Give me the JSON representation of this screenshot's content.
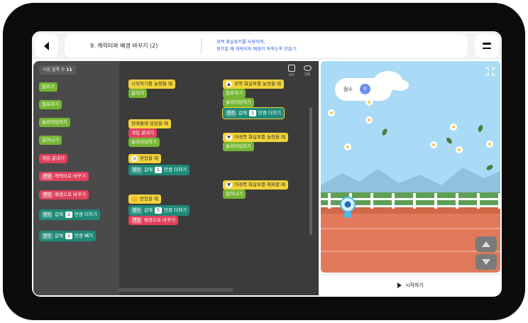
{
  "header": {
    "lesson_title": "9. 캐릭터와 배경 바꾸기 (2)",
    "description_line1": "위쪽 화살표키를 사용하여,",
    "description_line2": "점프할 때 캐릭터와 배경이 바뀌도록 만들기."
  },
  "palette": {
    "count_label": "사용 블록 수",
    "count_value": "11",
    "blocks": {
      "run": "달리기",
      "jump": "점프하기",
      "slide": "슬라이딩하기",
      "stand": "일어나기",
      "end_game": "게임 끝내기",
      "change_char_pick": "랜덤",
      "change_char_text": "캐릭터로 바꾸기",
      "change_bg_pick": "랜덤",
      "change_bg_text": "배경으로 바꾸기",
      "add_var": "점수",
      "add_mid": "값에",
      "add_num": "1",
      "add_text": "만큼 더하기",
      "sub_var": "점수",
      "sub_mid": "값에",
      "sub_num": "1",
      "sub_text": "만큼 빼기"
    }
  },
  "toolbar": {
    "code_label": "코드",
    "view_label": "전화"
  },
  "workspace": {
    "start_event": "시작하기를 눌렀을 때",
    "start_run": "달리기",
    "obstacle_event": "장애물에 닿았을 때",
    "obstacle_end": "게임 끝내기",
    "obstacle_slide": "슬라이딩하기",
    "get1_event": "얻었을 때",
    "get1_var": "점수",
    "get1_mid": "값에",
    "get1_num": "1",
    "get1_text": "만큼 더하기",
    "get2_event": "얻었을 때",
    "get2_var": "점수",
    "get2_mid": "값에",
    "get2_num": "5",
    "get2_text": "만큼 더하기",
    "get2_pick": "랜덤",
    "get2_bg": "배경으로 바꾸기",
    "up_event": "위쪽 화살표를 눌렀을 때",
    "up_jump": "점프하기",
    "up_slide": "슬라이딩하기",
    "up_var": "점수",
    "up_mid": "값에",
    "up_num": "1",
    "up_text": "만큼 더하기",
    "down_event": "아래쪽 화살표를 눌렀을 때",
    "down_slide": "슬라이딩하기",
    "release_event": "아래쪽 화살표를 해제할 때",
    "release_stand": "일어나기"
  },
  "stage": {
    "score_label": "점수",
    "score_value": "0",
    "start_label": "시작하기"
  }
}
